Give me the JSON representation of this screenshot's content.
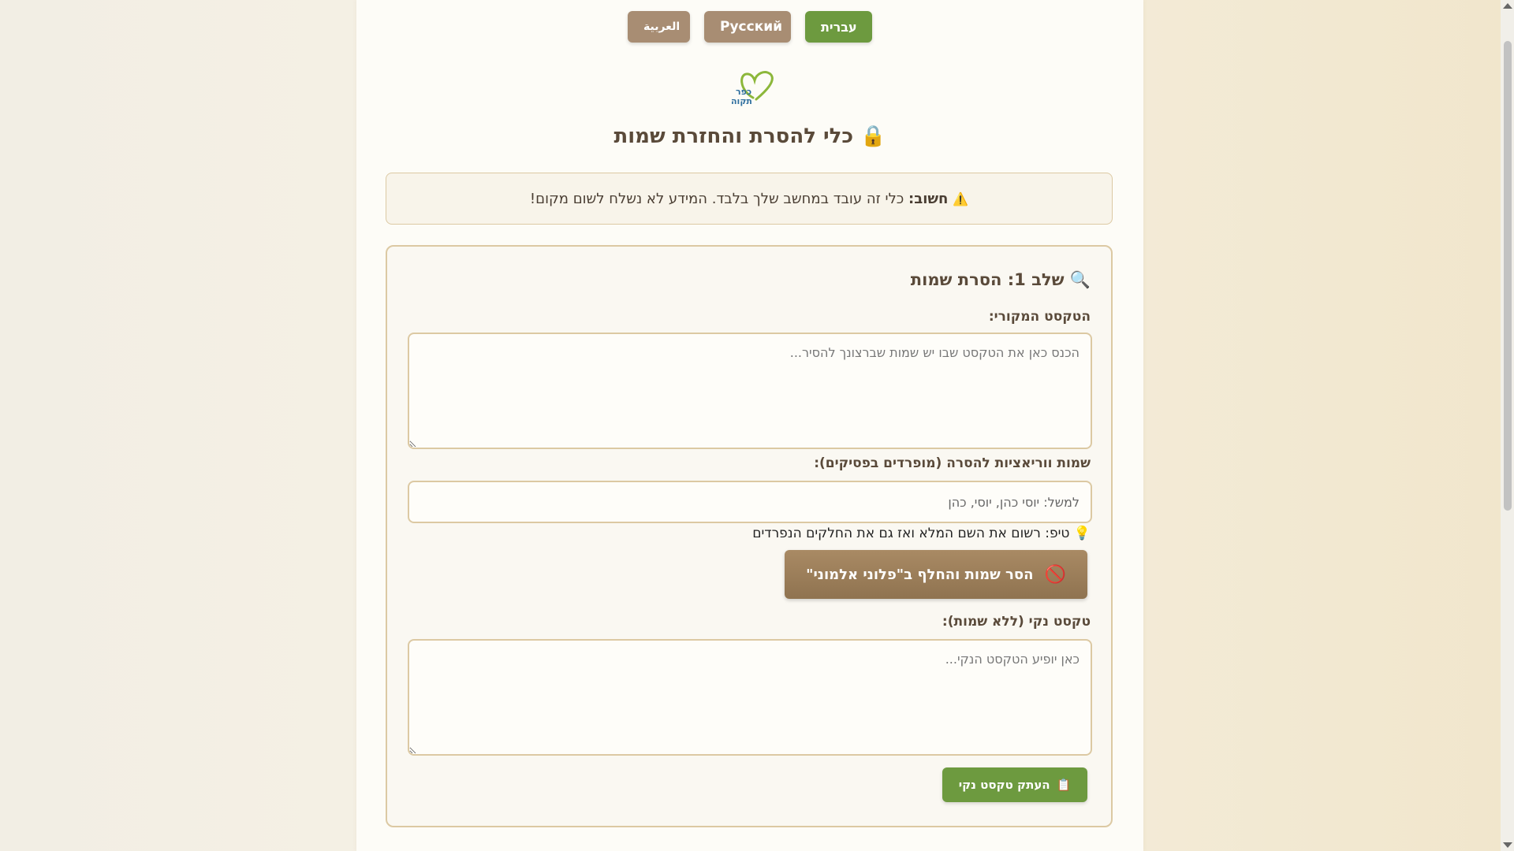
{
  "languages": [
    {
      "label": "العربية",
      "active": false
    },
    {
      "label": "Русский",
      "active": false
    },
    {
      "label": "עברית",
      "active": true
    }
  ],
  "logo": {
    "text_line1": "כפר",
    "text_line2": "תקוה"
  },
  "header": {
    "title": "כלי להסרת והחזרת שמות",
    "icon": "lock-icon"
  },
  "notice": {
    "icon": "warning-icon",
    "strong": "חשוב:",
    "text": " כלי זה עובד במחשב שלך בלבד. המידע לא נשלח לשום מקום!"
  },
  "step1": {
    "icon": "magnifier-icon",
    "title": "שלב 1: הסרת שמות",
    "original_label": "הטקסט המקורי:",
    "original_placeholder": "הכנס כאן את הטקסט שבו יש שמות שברצונך להסיר...",
    "original_value": "",
    "names_label": "שמות ווריאציות להסרה (מופרדים בפסיקים):",
    "names_placeholder": "למשל: יוסי כהן, יוסי, כהן",
    "names_value": "",
    "tip_icon": "lightbulb-icon",
    "tip": "טיפ: רשום את השם המלא ואז גם את החלקים הנפרדים",
    "remove_button_icon": "no-entry-icon",
    "remove_button": "הסר שמות והחלף ב\"פלוני אלמוני\"",
    "clean_label": "טקסט נקי (ללא שמות):",
    "clean_placeholder": "כאן יופיע הטקסט הנקי...",
    "clean_value": "",
    "copy_button_icon": "clipboard-icon",
    "copy_button": "העתק טקסט נקי"
  },
  "colors": {
    "accent_green": "#6d9a3f",
    "accent_brown": "#a88d73",
    "border": "#dcc9a3"
  }
}
